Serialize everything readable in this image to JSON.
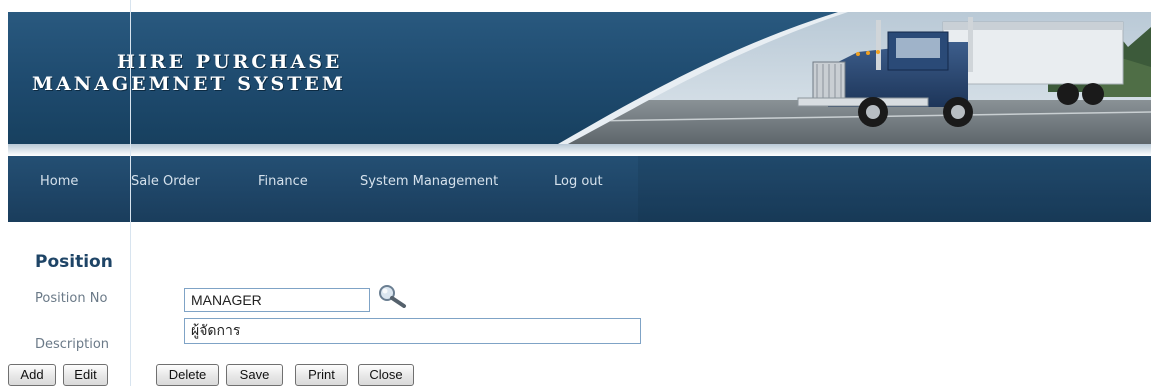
{
  "banner": {
    "title_line1": "HIRE PURCHASE",
    "title_line2": "MANAGEMNET SYSTEM",
    "image": "truck-photo"
  },
  "nav": {
    "items": [
      {
        "label": "Home"
      },
      {
        "label": "Sale Order"
      },
      {
        "label": "Finance"
      },
      {
        "label": "System Management"
      },
      {
        "label": "Log out"
      }
    ]
  },
  "form": {
    "title": "Position",
    "position_no": {
      "label": "Position No",
      "value": "MANAGER"
    },
    "description": {
      "label": "Description",
      "value": "ผู้จัดการ"
    },
    "search_icon": "magnifier-icon"
  },
  "toolbar": {
    "add_label": "Add",
    "edit_label": "Edit",
    "delete_label": "Delete",
    "save_label": "Save",
    "print_label": "Print",
    "close_label": "Close"
  },
  "colors": {
    "banner": "#1e4a6e",
    "nav": "#1f4668",
    "title": "#1e4466",
    "input_border": "#7fa3c6"
  }
}
